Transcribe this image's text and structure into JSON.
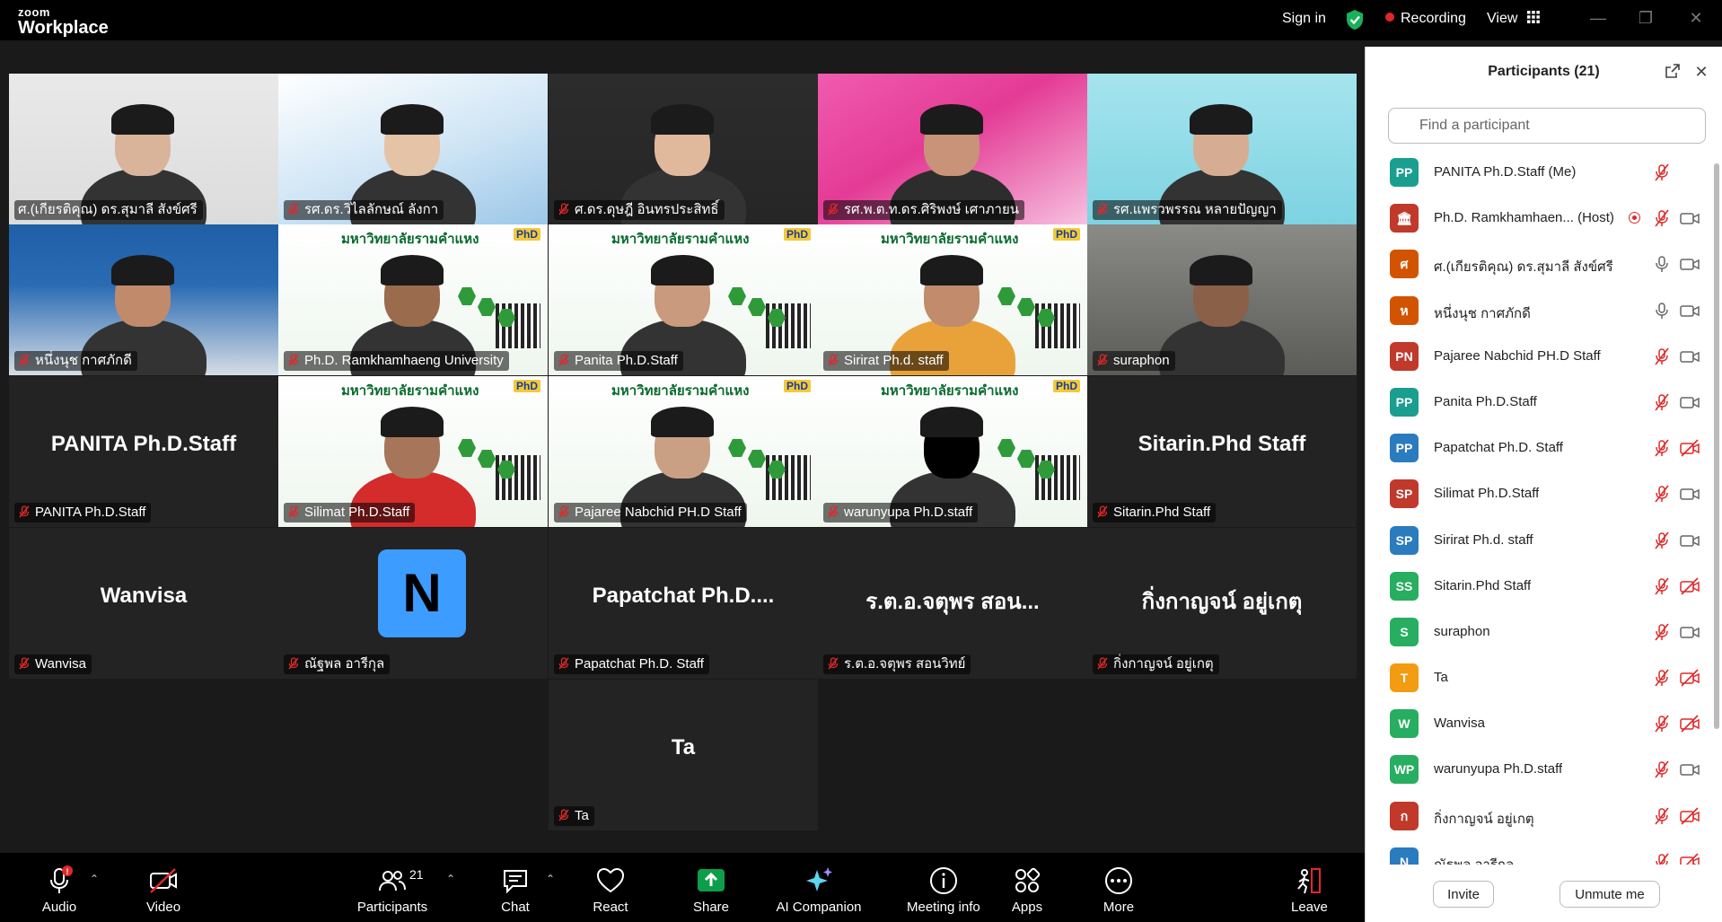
{
  "app": {
    "logo_top": "zoom",
    "logo_bottom": "Workplace"
  },
  "titlebar": {
    "sign_in": "Sign in",
    "recording": "Recording",
    "view": "View"
  },
  "gallery": {
    "tiles": [
      {
        "name": "ศ.(เกียรติคุณ) ดร.สุมาลี สังข์ศรี",
        "kind": "video",
        "active": true
      },
      {
        "name": "รศ.ดร.วิไลลักษณ์ ลังกา",
        "kind": "video"
      },
      {
        "name": "ศ.ดร.ดุษฎี อินทรประสิทธิ์",
        "kind": "video"
      },
      {
        "name": "รศ.พ.ต.ท.ดร.ศิริพงษ์ เศาภายน",
        "kind": "video"
      },
      {
        "name": "รศ.แพรวพรรณ หลายปัญญา",
        "kind": "video"
      },
      {
        "name": "หนึ่งนุช กาศภักดี",
        "kind": "video"
      },
      {
        "name": "Ph.D. Ramkhamhaeng University",
        "kind": "video"
      },
      {
        "name": "Panita Ph.D.Staff",
        "kind": "video"
      },
      {
        "name": "Sirirat Ph.d. staff",
        "kind": "video"
      },
      {
        "name": "suraphon",
        "kind": "video"
      },
      {
        "name": "PANITA Ph.D.Staff",
        "bigname": "PANITA Ph.D.Staff",
        "kind": "name"
      },
      {
        "name": "Silimat Ph.D.Staff",
        "kind": "video"
      },
      {
        "name": "Pajaree Nabchid PH.D Staff",
        "kind": "video"
      },
      {
        "name": "warunyupa Ph.D.staff",
        "kind": "video"
      },
      {
        "name": "Sitarin.Phd Staff",
        "bigname": "Sitarin.Phd Staff",
        "kind": "name"
      },
      {
        "name": "Wanvisa",
        "bigname": "Wanvisa",
        "kind": "name"
      },
      {
        "name": "ณัฐพล อารีกุล",
        "avatar_letter": "N",
        "kind": "avatar"
      },
      {
        "name": "Papatchat Ph.D. Staff",
        "bigname": "Papatchat Ph.D....",
        "kind": "name"
      },
      {
        "name": "ร.ต.อ.จตุพร สอนวิทย์",
        "bigname": "ร.ต.อ.จตุพร สอน...",
        "kind": "name"
      },
      {
        "name": "กิ่งกาญจน์ อยู่เกตุ",
        "bigname": "กิ่งกาญจน์ อยู่เกตุ",
        "kind": "name"
      },
      {
        "name": "Ta",
        "bigname": "Ta",
        "kind": "name"
      }
    ],
    "banner_text": "มหาวิทยาลัยรามคำแหง",
    "banner_logo": "PhD"
  },
  "panel": {
    "title": "Participants (21)",
    "search_placeholder": "Find a participant",
    "participants": [
      {
        "initials": "PP",
        "name": "PANITA Ph.D.Staff (Me)",
        "color": "#1a9e8f",
        "mic": "muted",
        "cam": "none"
      },
      {
        "initials": "🏛",
        "name": "Ph.D. Ramkhamhaen...  (Host)",
        "color": "#c0392b",
        "mic": "muted",
        "cam": "on",
        "host": true
      },
      {
        "initials": "ศ",
        "name": "ศ.(เกียรติคุณ) ดร.สุมาลี สังข์ศรี",
        "color": "#d35400",
        "mic": "on",
        "cam": "on"
      },
      {
        "initials": "ห",
        "name": "หนึ่งนุช กาศภักดี",
        "color": "#d35400",
        "mic": "on",
        "cam": "on"
      },
      {
        "initials": "PN",
        "name": "Pajaree Nabchid PH.D Staff",
        "color": "#c0392b",
        "mic": "muted",
        "cam": "on"
      },
      {
        "initials": "PP",
        "name": "Panita Ph.D.Staff",
        "color": "#1a9e8f",
        "mic": "muted",
        "cam": "on"
      },
      {
        "initials": "PP",
        "name": "Papatchat Ph.D. Staff",
        "color": "#2b7bbf",
        "mic": "muted",
        "cam": "off"
      },
      {
        "initials": "SP",
        "name": "Silimat Ph.D.Staff",
        "color": "#c0392b",
        "mic": "muted",
        "cam": "on"
      },
      {
        "initials": "SP",
        "name": "Sirirat Ph.d. staff",
        "color": "#2b7bbf",
        "mic": "muted",
        "cam": "on"
      },
      {
        "initials": "SS",
        "name": "Sitarin.Phd Staff",
        "color": "#27ae60",
        "mic": "muted",
        "cam": "off"
      },
      {
        "initials": "S",
        "name": "suraphon",
        "color": "#27ae60",
        "mic": "muted",
        "cam": "on"
      },
      {
        "initials": "T",
        "name": "Ta",
        "color": "#f39c12",
        "mic": "muted",
        "cam": "off"
      },
      {
        "initials": "W",
        "name": "Wanvisa",
        "color": "#27ae60",
        "mic": "muted",
        "cam": "off"
      },
      {
        "initials": "WP",
        "name": "warunyupa Ph.D.staff",
        "color": "#27ae60",
        "mic": "muted",
        "cam": "on"
      },
      {
        "initials": "ก",
        "name": "กิ่งกาญจน์ อยู่เกตุ",
        "color": "#c0392b",
        "mic": "muted",
        "cam": "off"
      },
      {
        "initials": "N",
        "name": "ณัฐพล อารีกุล",
        "color": "#2b7bbf",
        "mic": "muted",
        "cam": "off"
      }
    ],
    "invite": "Invite",
    "unmute": "Unmute me"
  },
  "toolbar": {
    "audio": "Audio",
    "audio_badge": "!",
    "video": "Video",
    "participants": "Participants",
    "participants_count": "21",
    "chat": "Chat",
    "react": "React",
    "share": "Share",
    "ai_companion": "AI Companion",
    "meeting_info": "Meeting info",
    "apps": "Apps",
    "more": "More",
    "leave": "Leave"
  },
  "colors": {
    "accent_green": "#2bd96b",
    "share_green": "#0e9e4b",
    "mute_red": "#e02828",
    "recording_red": "#e02828"
  }
}
